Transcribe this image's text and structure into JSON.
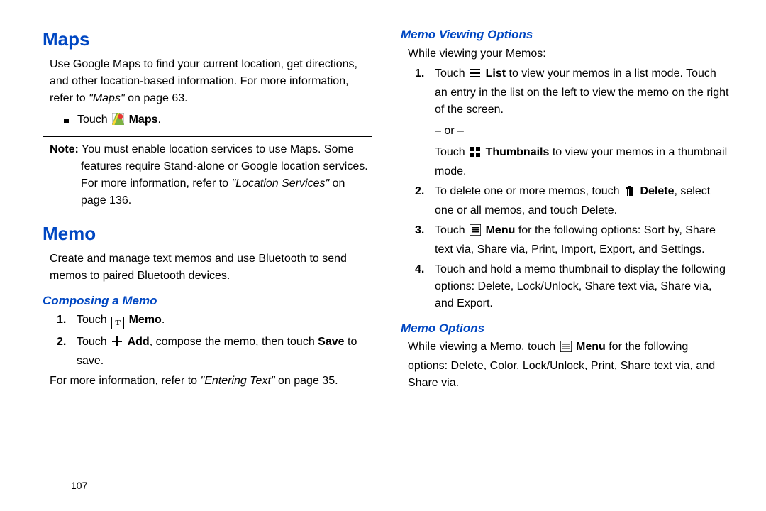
{
  "page_number": "107",
  "col1": {
    "maps": {
      "heading": "Maps",
      "intro_a": "Use Google Maps to find your current location, get directions, and other location-based information. For more information, refer to ",
      "intro_ref": "\"Maps\"",
      "intro_b": " on page 63.",
      "touch": "Touch ",
      "maps_label": "Maps",
      "period": ".",
      "note_label": "Note:",
      "note_a": " You must enable location services to use Maps. Some features require Stand-alone or Google location services. For more information, refer to ",
      "note_ref": "\"Location Services\"",
      "note_b": " on page 136."
    },
    "memo": {
      "heading": "Memo",
      "intro": "Create and manage text memos and use Bluetooth to send memos to paired Bluetooth devices.",
      "composing_heading": "Composing a Memo",
      "s1_a": "Touch ",
      "s1_b": "Memo",
      "s1_c": ".",
      "s2_a": "Touch ",
      "s2_b": "Add",
      "s2_c": ", compose the memo, then touch ",
      "s2_d": "Save",
      "s2_e": " to save.",
      "more_a": "For more information, refer to ",
      "more_ref": "\"Entering Text\"",
      "more_b": " on page 35."
    }
  },
  "col2": {
    "viewing": {
      "heading": "Memo Viewing Options",
      "intro": "While viewing your Memos:",
      "s1_a": "Touch ",
      "s1_b": "List",
      "s1_c": " to view your memos in a list mode. Touch an entry in the list on the left to view the memo on the right of the screen.",
      "or": "– or –",
      "s1_d": "Touch ",
      "s1_e": "Thumbnails",
      "s1_f": " to view your memos in a thumbnail mode.",
      "s2_a": "To delete one or more memos, touch ",
      "s2_b": "Delete",
      "s2_c": ", select one or all memos, and touch Delete.",
      "s3_a": "Touch ",
      "s3_b": "Menu",
      "s3_c": " for the following options: Sort by, Share text via, Share via, Print, Import, Export, and Settings.",
      "s4": "Touch and hold a memo thumbnail to display the following options: Delete, Lock/Unlock, Share text via, Share via, and Export."
    },
    "options": {
      "heading": "Memo Options",
      "a": "While viewing a Memo, touch ",
      "b": "Menu",
      "c": " for the following options: Delete, Color, Lock/Unlock, Print, Share text via, and Share via."
    }
  }
}
